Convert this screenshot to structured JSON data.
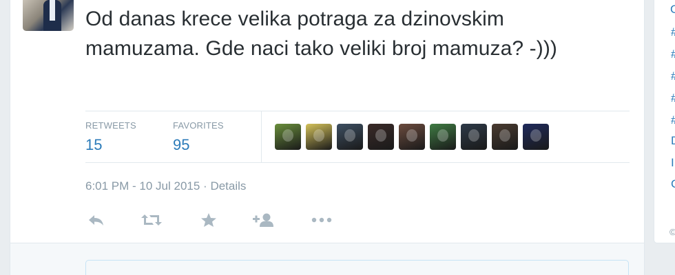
{
  "tweet": {
    "text": "Od danas krece velika potraga za dzinovskim mamuzama. Gde naci tako veliki broj mamuza? -)))",
    "timestamp": "6:01 PM - 10 Jul 2015",
    "separator": " · ",
    "details_label": "Details"
  },
  "stats": {
    "retweets_label": "RETWEETS",
    "retweets_value": "15",
    "favorites_label": "FAVORITES",
    "favorites_value": "95"
  },
  "favoriter_avatars": [
    {
      "name": "favoriter-avatar-1",
      "color": "#6a8f3c"
    },
    {
      "name": "favoriter-avatar-2",
      "color": "#d4c25a"
    },
    {
      "name": "favoriter-avatar-3",
      "color": "#3d4f62"
    },
    {
      "name": "favoriter-avatar-4",
      "color": "#3a2a28"
    },
    {
      "name": "favoriter-avatar-5",
      "color": "#6b4b3e"
    },
    {
      "name": "favoriter-avatar-6",
      "color": "#3f7b43"
    },
    {
      "name": "favoriter-avatar-7",
      "color": "#2e3a48"
    },
    {
      "name": "favoriter-avatar-8",
      "color": "#4a3b30"
    },
    {
      "name": "favoriter-avatar-9",
      "color": "#1f2a5c"
    }
  ],
  "actions": [
    {
      "name": "reply-icon",
      "label": "Reply"
    },
    {
      "name": "retweet-icon",
      "label": "Retweet"
    },
    {
      "name": "favorite-icon",
      "label": "Favorite"
    },
    {
      "name": "follow-icon",
      "label": "Follow"
    },
    {
      "name": "more-icon",
      "label": "More"
    }
  ],
  "right_panel": {
    "trend_fragments": [
      "#",
      "#",
      "#",
      "#",
      "#",
      "D",
      "I",
      "C"
    ],
    "top_fragment": "C",
    "footer_fragment": "©"
  },
  "colors": {
    "accent": "#2b7bb9",
    "muted": "#8899a6",
    "text": "#292f33"
  }
}
